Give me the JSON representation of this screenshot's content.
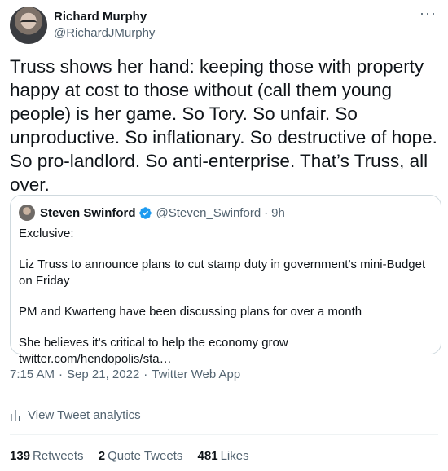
{
  "author": {
    "display_name": "Richard Murphy",
    "handle": "@RichardJMurphy"
  },
  "more_icon_glyph": "···",
  "tweet_text": "Truss shows her hand: keeping those with property happy at cost to those without (call them young people) is her game. So Tory. So unfair. So unproductive. So inflationary. So destructive of hope. So pro-landlord. So anti-enterprise. That’s Truss, all over.",
  "quoted": {
    "display_name": "Steven Swinford",
    "handle": "@Steven_Swinford",
    "separator": "·",
    "time": "9h",
    "verified_color": "#1d9bf0",
    "paragraphs": [
      "Exclusive:",
      "Liz Truss to announce plans to cut stamp duty in government’s mini-Budget on Friday",
      "PM and Kwarteng have been discussing plans for over a month",
      "She believes it’s critical to help the economy grow twitter.com/hendopolis/sta…"
    ]
  },
  "meta": {
    "time": "7:15 AM",
    "separator": "·",
    "date": "Sep 21, 2022",
    "source": "Twitter Web App"
  },
  "analytics_label": "View Tweet analytics",
  "stats": {
    "retweets_count": "139",
    "retweets_label": "Retweets",
    "quotes_count": "2",
    "quotes_label": "Quote Tweets",
    "likes_count": "481",
    "likes_label": "Likes"
  },
  "colors": {
    "text_primary": "#0f1419",
    "text_secondary": "#536471",
    "border": "#cfd9de",
    "accent": "#1d9bf0"
  }
}
